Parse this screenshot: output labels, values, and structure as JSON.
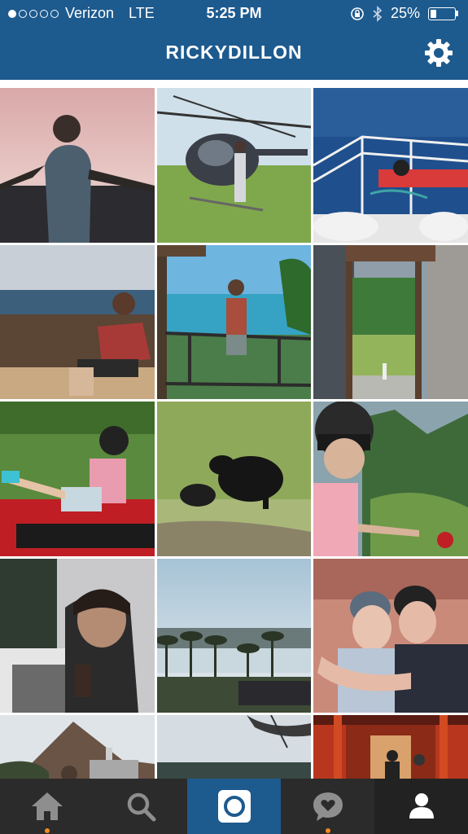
{
  "status_bar": {
    "carrier": "Verizon",
    "network": "LTE",
    "time": "5:25 PM",
    "battery": "25%",
    "battery_level": 0.25
  },
  "header": {
    "title": "RICKYDILLON",
    "settings_icon": "gear-icon"
  },
  "colors": {
    "header_bg": "#1d5a8e",
    "tabbar_bg": "#2b2b2b",
    "active_tab_bg": "#1d5a8e",
    "notification_dot": "#f58a1f"
  },
  "grid": {
    "columns": 3,
    "photos": [
      "sunset-balcony",
      "helicopter",
      "boat-railing",
      "beach-rocks",
      "balcony-ocean",
      "wooden-gate",
      "atv-ride",
      "black-cow",
      "helmet-selfie",
      "dark-selfie",
      "palm-trees",
      "couple-selfie",
      "mountain-castle",
      "cloudy-sky",
      "torii-gates"
    ]
  },
  "tabbar": {
    "tabs": [
      {
        "name": "home",
        "icon": "home-icon",
        "active": false,
        "notification": true
      },
      {
        "name": "search",
        "icon": "search-icon",
        "active": false,
        "notification": false
      },
      {
        "name": "camera",
        "icon": "camera-icon",
        "active": true,
        "notification": false
      },
      {
        "name": "activity",
        "icon": "heart-bubble-icon",
        "active": false,
        "notification": true
      },
      {
        "name": "profile",
        "icon": "person-icon",
        "active": false,
        "notification": false
      }
    ]
  }
}
